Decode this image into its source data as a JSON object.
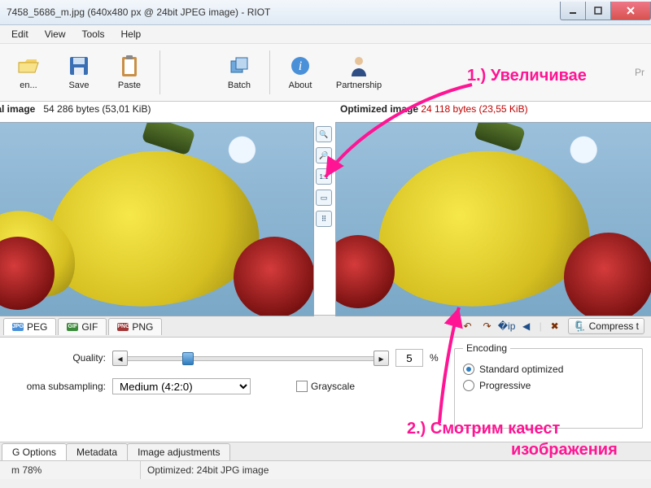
{
  "window": {
    "title": "7458_5686_m.jpg (640x480 px @ 24bit JPEG image) - RIOT"
  },
  "menu": {
    "edit": "Edit",
    "view": "View",
    "tools": "Tools",
    "help": "Help"
  },
  "toolbar": {
    "open": "en...",
    "save": "Save",
    "paste": "Paste",
    "batch": "Batch",
    "about": "About",
    "partnership": "Partnership",
    "pr": "Pr"
  },
  "panes": {
    "left": {
      "label": "ial image",
      "bytes": "54 286 bytes (53,01 KiB)"
    },
    "right": {
      "label": "Optimized image",
      "bytes": "24 118 bytes (23,55 KiB)"
    }
  },
  "midtools": {
    "zoomin": "+",
    "zoomout": "−",
    "fit": "1:1"
  },
  "fmt": {
    "jpeg": "PEG",
    "gif": "GIF",
    "png": "PNG",
    "compress": "Compress t"
  },
  "opts": {
    "quality_label": "Quality:",
    "quality_value": "5",
    "quality_pct": "%",
    "subsampling_label": "oma subsampling:",
    "subsampling_value": "Medium (4:2:0)",
    "grayscale": "Grayscale"
  },
  "encoding": {
    "legend": "Encoding",
    "standard": "Standard optimized",
    "progressive": "Progressive"
  },
  "btabs": {
    "opts": "G Options",
    "meta": "Metadata",
    "adj": "Image adjustments"
  },
  "status": {
    "zoom": "m 78%",
    "info": "Optimized: 24bit JPG image"
  },
  "annotations": {
    "a1": "1.) Увеличивае",
    "a2a": "2.) Смотрим качест",
    "a2b": "изображения"
  }
}
